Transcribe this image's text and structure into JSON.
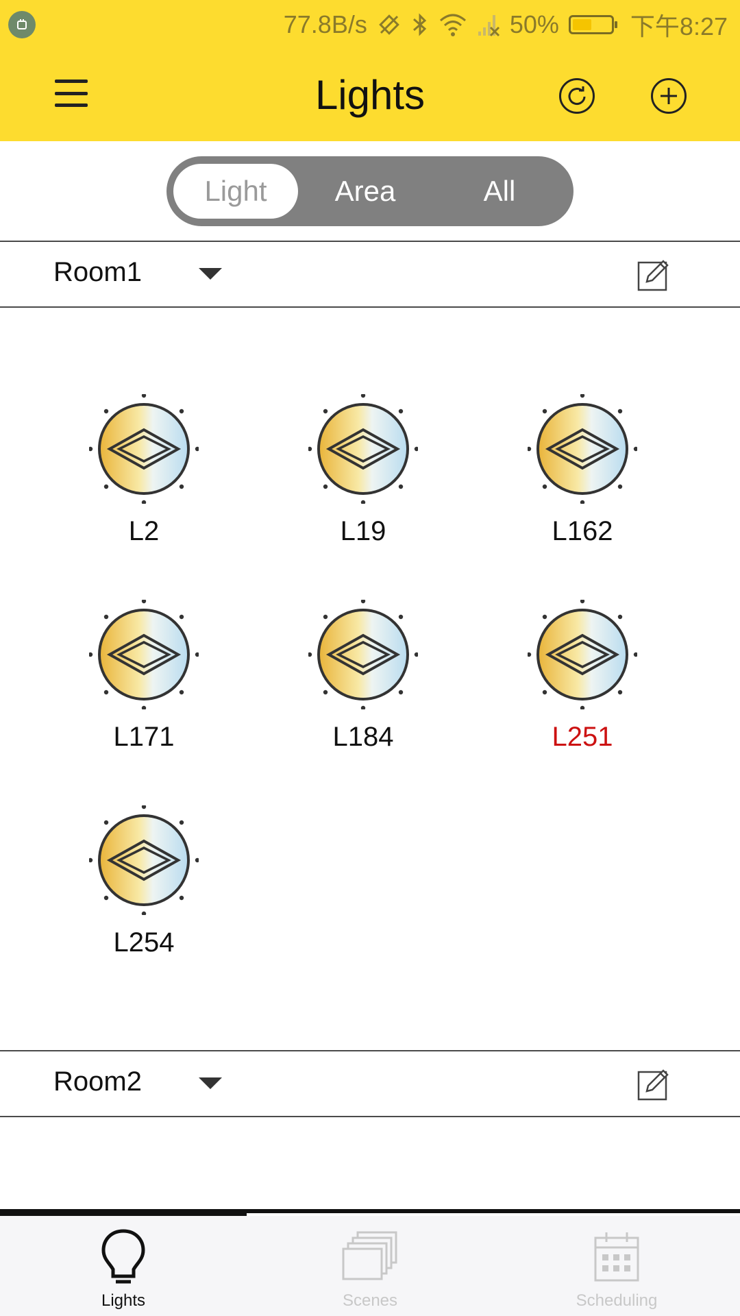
{
  "status_bar": {
    "speed": "77.8B/s",
    "battery": "50%",
    "battery_level": 0.5,
    "time": "下午8:27",
    "icons": [
      "app-badge-icon",
      "rotate-icon",
      "bluetooth-icon",
      "wifi-icon",
      "signal-icon",
      "battery-icon"
    ]
  },
  "header": {
    "title": "Lights",
    "background": "#fddc2f"
  },
  "tabs": {
    "items": [
      "Light",
      "Area",
      "All"
    ],
    "selected": "Light"
  },
  "rooms": [
    {
      "name": "Room1",
      "lights": [
        "L2",
        "L19",
        "L162",
        "L171",
        "L184",
        "L251",
        "L254"
      ],
      "alert_light": "L251"
    },
    {
      "name": "Room2",
      "lights": []
    }
  ],
  "bottom_nav": {
    "items": [
      {
        "label": "Lights",
        "icon": "bulb-icon",
        "active": true
      },
      {
        "label": "Scenes",
        "icon": "scenes-icon",
        "active": false
      },
      {
        "label": "Scheduling",
        "icon": "calendar-icon",
        "active": false
      }
    ]
  },
  "colors": {
    "accent": "#fddc2f",
    "alert": "#cc1111",
    "segment_bg": "#808080"
  }
}
